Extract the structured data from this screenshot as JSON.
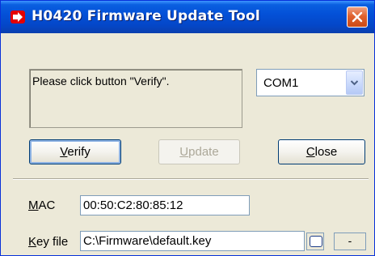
{
  "window": {
    "title": "H0420 Firmware Update Tool",
    "colors": {
      "titlebar": "#0451d8",
      "close_button": "#e0622f",
      "background": "#ece9d8"
    }
  },
  "message": "Please click button \"Verify\".",
  "port_select": {
    "value": "COM1"
  },
  "buttons": {
    "verify": {
      "mnemonic": "V",
      "rest": "erify"
    },
    "update": {
      "mnemonic": "U",
      "rest": "pdate"
    },
    "close": {
      "mnemonic": "C",
      "rest": "lose"
    }
  },
  "mac": {
    "mnemonic": "M",
    "rest": "AC",
    "value": "00:50:C2:80:85:12"
  },
  "key_file": {
    "mnemonic": "K",
    "rest": "ey file",
    "value": "C:\\Firmware\\default.key",
    "option_label": "-"
  },
  "icons": [
    "app-icon",
    "close-icon",
    "dropdown-arrow-icon",
    "checkbox-icon"
  ]
}
